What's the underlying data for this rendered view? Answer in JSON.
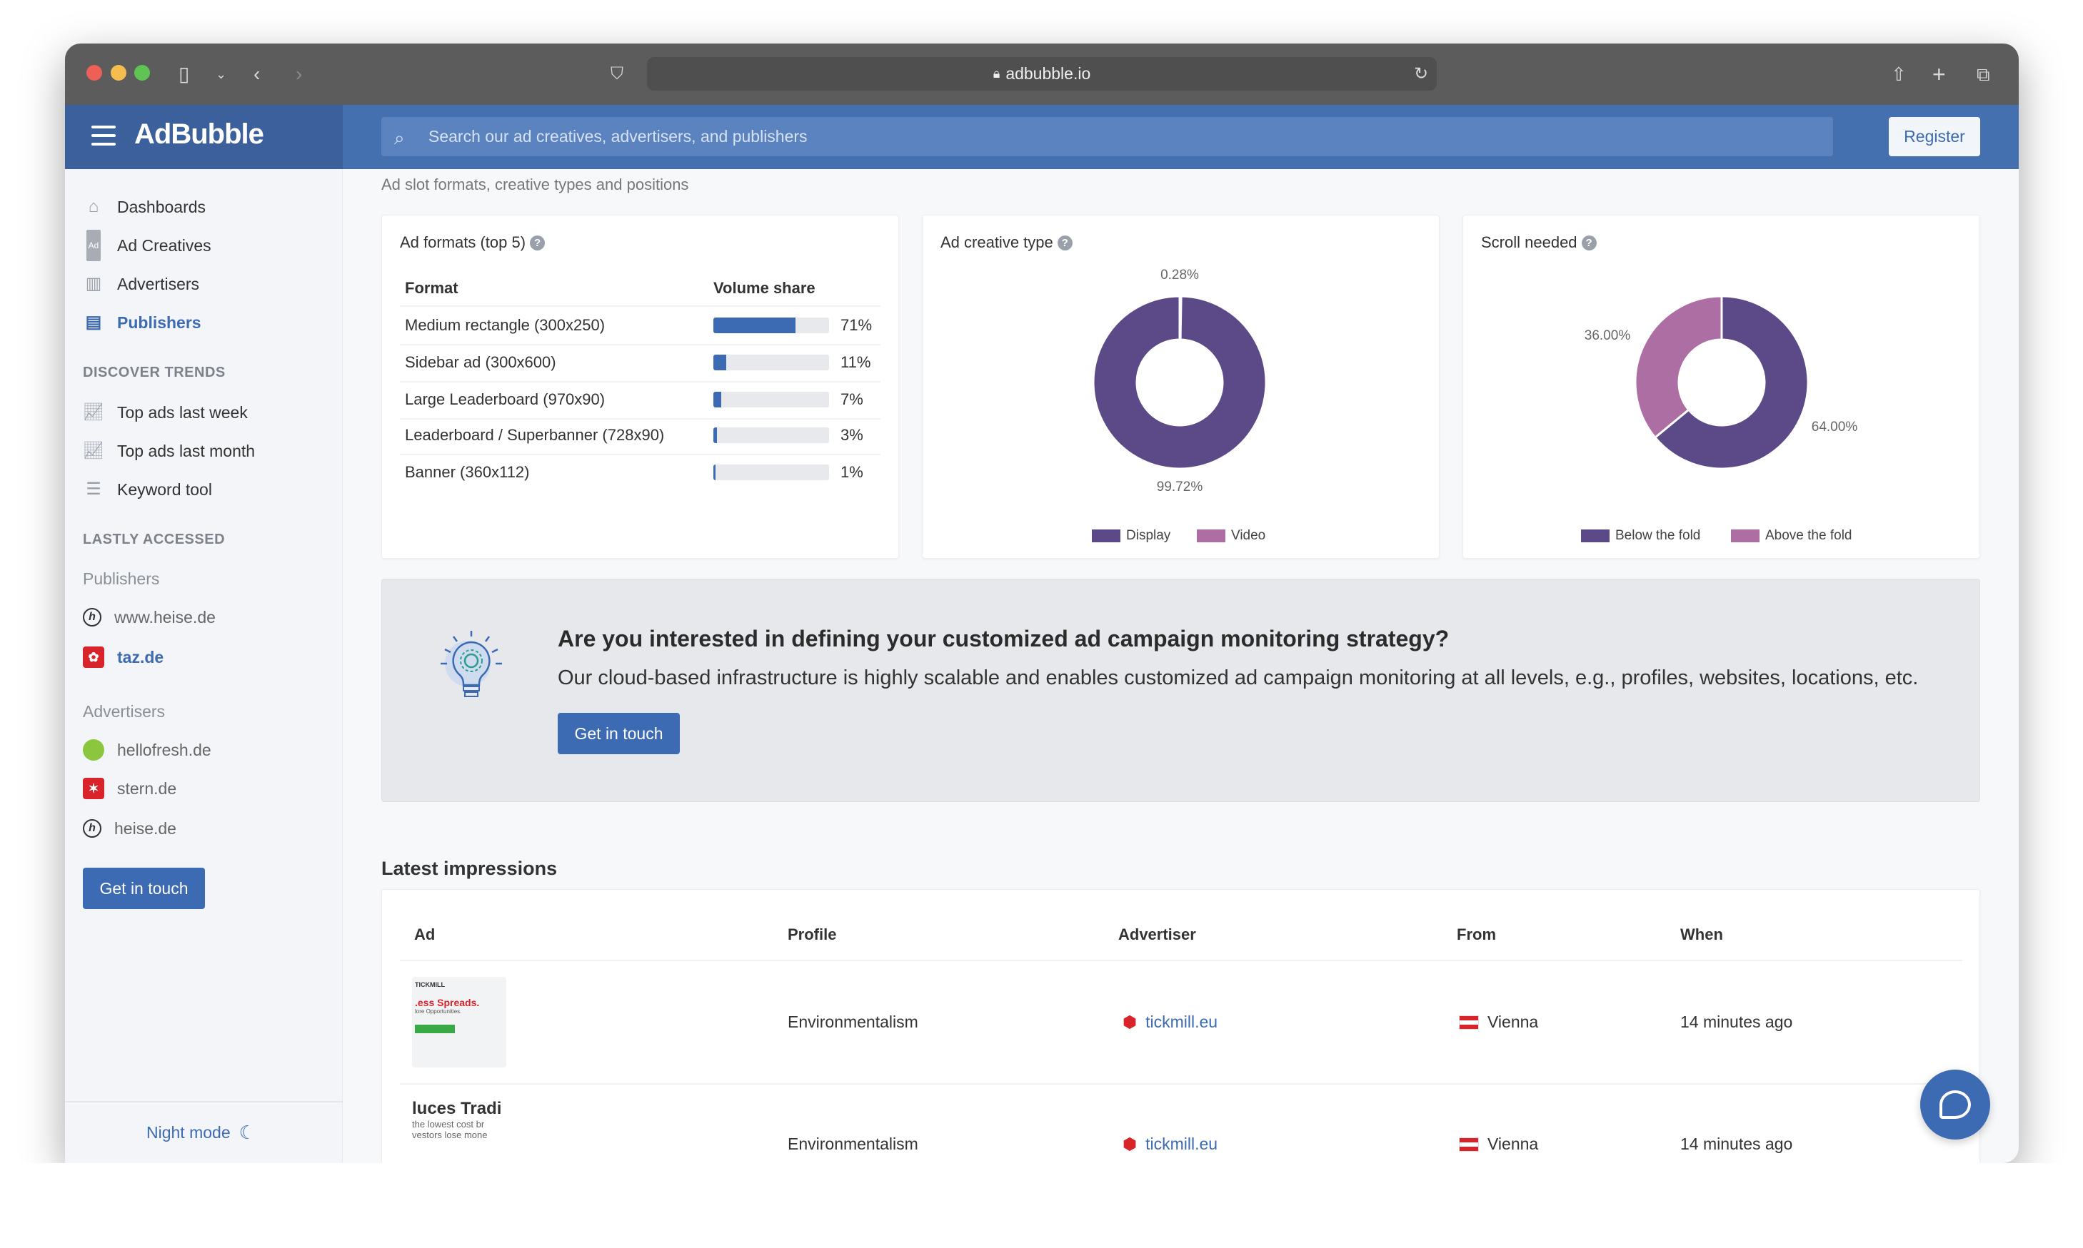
{
  "browser": {
    "url": "adbubble.io"
  },
  "header": {
    "logo": "AdBubble",
    "search_placeholder": "Search our ad creatives, advertisers, and publishers",
    "register": "Register"
  },
  "sidebar": {
    "nav": [
      {
        "label": "Dashboards",
        "icon": "home-icon"
      },
      {
        "label": "Ad Creatives",
        "icon": "ad-icon"
      },
      {
        "label": "Advertisers",
        "icon": "building-icon"
      },
      {
        "label": "Publishers",
        "icon": "browser-window-icon",
        "active": true
      }
    ],
    "discover_title": "DISCOVER TRENDS",
    "discover": [
      {
        "label": "Top ads last week",
        "icon": "chart-line-icon"
      },
      {
        "label": "Top ads last month",
        "icon": "chart-line-icon"
      },
      {
        "label": "Keyword tool",
        "icon": "list-icon"
      }
    ],
    "lastly_title": "LASTLY ACCESSED",
    "publishers_title": "Publishers",
    "publishers": [
      {
        "label": "www.heise.de"
      },
      {
        "label": "taz.de",
        "active": true
      }
    ],
    "advertisers_title": "Advertisers",
    "advertisers": [
      {
        "label": "hellofresh.de"
      },
      {
        "label": "stern.de"
      },
      {
        "label": "heise.de"
      }
    ],
    "cta": "Get in touch",
    "night_mode": "Night mode"
  },
  "main": {
    "subtitle": "Ad slot formats, creative types and positions",
    "formats": {
      "title": "Ad formats (top 5)",
      "col_format": "Format",
      "col_share": "Volume share",
      "rows": [
        {
          "label": "Medium rectangle (300x250)",
          "value": 71,
          "pct": "71%"
        },
        {
          "label": "Sidebar ad (300x600)",
          "value": 11,
          "pct": "11%"
        },
        {
          "label": "Large Leaderboard (970x90)",
          "value": 7,
          "pct": "7%"
        },
        {
          "label": "Leaderboard / Superbanner (728x90)",
          "value": 3,
          "pct": "3%"
        },
        {
          "label": "Banner (360x112)",
          "value": 1,
          "pct": "1%"
        }
      ]
    },
    "banner": {
      "heading": "Are you interested in defining your customized ad campaign monitoring strategy?",
      "text": "Our cloud-based infrastructure is highly scalable and enables customized ad campaign monitoring at all levels, e.g., profiles, websites, locations, etc.",
      "button": "Get in touch"
    },
    "impressions": {
      "title": "Latest impressions",
      "columns": [
        "Ad",
        "Profile",
        "Advertiser",
        "From",
        "When"
      ],
      "rows": [
        {
          "ad_thumb": {
            "brand": "TICKMILL",
            "headline": ".ess Spreads.",
            "sub": "lore Opportunities."
          },
          "profile": "Environmentalism",
          "advertiser": "tickmill.eu",
          "from": "Vienna",
          "when": "14 minutes ago"
        },
        {
          "ad_thumb": {
            "headline": "luces Tradi",
            "sub": "the lowest cost br",
            "sub2": "vestors lose mone"
          },
          "profile": "Environmentalism",
          "advertiser": "tickmill.eu",
          "from": "Vienna",
          "when": "14 minutes ago"
        }
      ]
    }
  },
  "colors": {
    "accent": "#3d6bb3",
    "purple": "#5b4a87",
    "pink": "#ad6fa3"
  },
  "chart_data": [
    {
      "type": "pie",
      "title": "Ad creative type",
      "categories": [
        "Display",
        "Video"
      ],
      "values": [
        99.72,
        0.28
      ],
      "labels": [
        "99.72%",
        "0.28%"
      ],
      "colors": [
        "#5b4a87",
        "#ad6fa3"
      ],
      "legend": "bottom",
      "donut": true
    },
    {
      "type": "pie",
      "title": "Scroll needed",
      "categories": [
        "Below the fold",
        "Above the fold"
      ],
      "values": [
        64.0,
        36.0
      ],
      "labels": [
        "64.00%",
        "36.00%"
      ],
      "colors": [
        "#5b4a87",
        "#ad6fa3"
      ],
      "legend": "bottom",
      "donut": true
    }
  ]
}
